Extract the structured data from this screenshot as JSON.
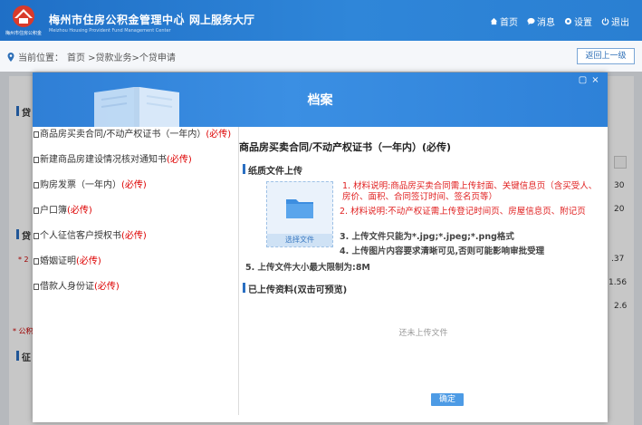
{
  "header": {
    "site_title": "梅州市住房公积金管理中心",
    "site_en": "Meizhou Housing Provident Fund Management Center",
    "logo_sub": "梅州市住房公积金",
    "site_sub": "网上服务大厅",
    "nav": [
      {
        "label": "首页",
        "icon": "home-icon"
      },
      {
        "label": "消息",
        "icon": "message-icon"
      },
      {
        "label": "设置",
        "icon": "gear-icon"
      },
      {
        "label": "退出",
        "icon": "power-icon"
      }
    ]
  },
  "breadcrumb": {
    "prefix": "当前位置：",
    "path": "首页 >贷款业务>个贷申请",
    "back": "返回上一级"
  },
  "background": {
    "sec1": "贷",
    "sec2": "贷",
    "sec3": "征",
    "mark1": "* 2",
    "mark2": "* 公积",
    "nums": [
      "30",
      "20",
      ".37",
      "1.56",
      "2.6"
    ]
  },
  "modal": {
    "title": "档案",
    "min_label": "▢",
    "close_label": "×",
    "docs": [
      {
        "label": "商品房买卖合同/不动产权证书（一年内）",
        "req": "(必传)"
      },
      {
        "label": "新建商品房建设情况核对通知书",
        "req": "(必传)"
      },
      {
        "label": "购房发票（一年内）",
        "req": "(必传)"
      },
      {
        "label": "户口簿",
        "req": "(必传)"
      },
      {
        "label": "个人征信客户授权书",
        "req": "(必传)"
      },
      {
        "label": "婚姻证明",
        "req": "(必传)"
      },
      {
        "label": "借款人身份证",
        "req": "(必传)"
      }
    ],
    "doc_title": "商品房买卖合同/不动产权证书（一年内）(必传)",
    "paper_section": "纸质文件上传",
    "upload_label": "选择文件",
    "notes": [
      "1. 材料说明:商品房买卖合同需上传封面、关键信息页（含买受人、房价、面积、合同签订时间、签名页等）",
      "2. 材料说明:不动产权证需上传登记时间页、房屋信息页、附记页",
      "3. 上传文件只能为*.jpg;*.jpeg;*.png格式",
      "4. 上传图片内容要求清晰可见,否则可能影响审批受理",
      "5. 上传文件大小最大限制为:8M"
    ],
    "uploaded_section": "已上传资料(双击可预览)",
    "empty_text": "还未上传文件",
    "ok": "确定"
  }
}
